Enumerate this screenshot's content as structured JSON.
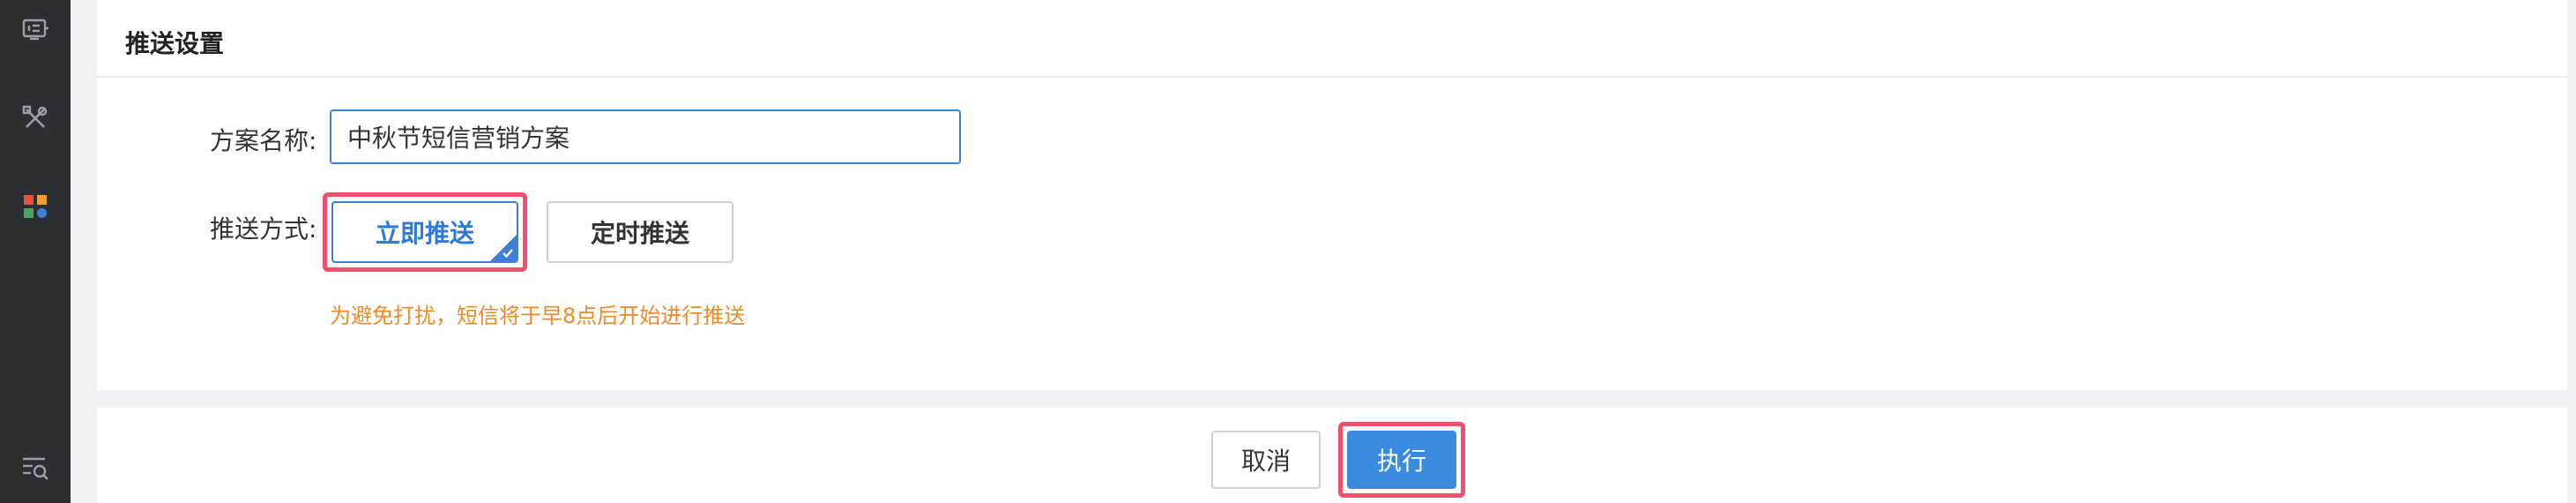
{
  "sidebar": {
    "icons": [
      {
        "name": "monitor-list-icon"
      },
      {
        "name": "tools-icon"
      },
      {
        "name": "apps-grid-icon",
        "colors": [
          "#e8523c",
          "#f0a030",
          "#4aa55a",
          "#3d7fd6"
        ]
      },
      {
        "name": "list-search-icon"
      }
    ]
  },
  "panel": {
    "title": "推送设置",
    "name_label": "方案名称:",
    "name_value": "中秋节短信营销方案",
    "mode_label": "推送方式:",
    "mode_options": [
      {
        "label": "立即推送",
        "selected": true
      },
      {
        "label": "定时推送",
        "selected": false
      }
    ],
    "hint": "为避免打扰，短信将于早8点后开始进行推送"
  },
  "footer": {
    "cancel_label": "取消",
    "execute_label": "执行"
  },
  "colors": {
    "accent": "#3d7fd6",
    "primary_button": "#3a8be0",
    "highlight": "#f0506e",
    "hint": "#f08a24",
    "sidebar_bg": "#2b2f33"
  }
}
